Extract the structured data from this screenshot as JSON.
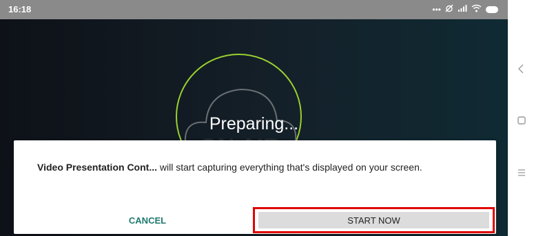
{
  "status": {
    "time": "16:18",
    "icons": [
      "more-dots-icon",
      "alarm-off-icon",
      "signal-icon",
      "wifi-icon",
      "battery-icon"
    ]
  },
  "main": {
    "logo_text": "ON AIR",
    "preparing_text": "Preparing..."
  },
  "dialog": {
    "app_name": "Video Presentation Cont...",
    "message": " will start capturing everything that's displayed on your screen.",
    "cancel_label": "CANCEL",
    "start_label": "START NOW"
  },
  "navigation": {
    "icons": [
      "back-icon",
      "home-icon",
      "menu-icon"
    ]
  },
  "colors": {
    "accent": "#1f7a6e",
    "ring": "#9ad12f",
    "highlight": "#e00000",
    "statusbar": "#8a8a8a"
  }
}
